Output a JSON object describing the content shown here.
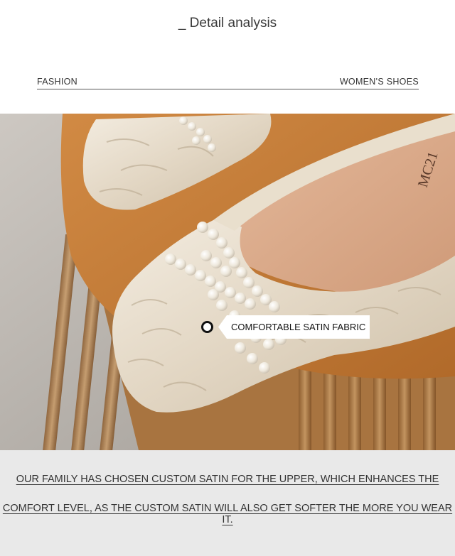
{
  "header": {
    "title": "_ Detail analysis",
    "left_label": "FASHION",
    "right_label": "WOMEN'S SHOES"
  },
  "photo": {
    "subject": "satin flat shoe with pearl bow",
    "callout_text": "COMFORTABLE SATIN FABRIC",
    "insole_print": "MC21"
  },
  "description": {
    "line1": "OUR FAMILY HAS CHOSEN CUSTOM SATIN FOR THE UPPER, WHICH ENHANCES THE",
    "line2": "COMFORT LEVEL, AS THE CUSTOM SATIN WILL ALSO GET SOFTER THE MORE YOU WEAR IT."
  },
  "colors": {
    "satin": "#e6dccb",
    "leather_tray": "#c77f3a",
    "insole": "#d9a98a",
    "pearl": "#f4f1ea",
    "bottom_band": "#e9e9e9"
  }
}
